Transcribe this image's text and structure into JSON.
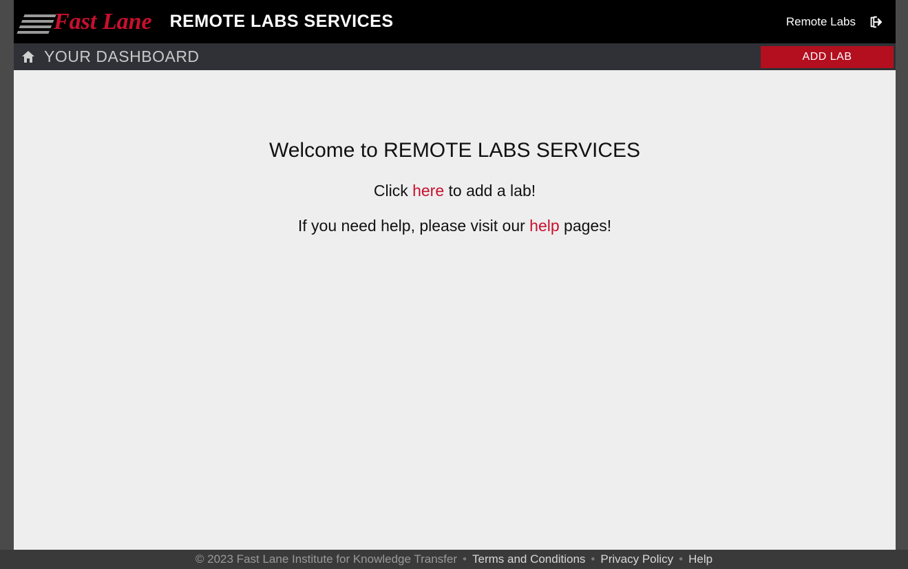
{
  "header": {
    "logo_text": "Fast Lane",
    "title": "REMOTE LABS SERVICES",
    "remote_labs_label": "Remote Labs"
  },
  "subheader": {
    "dashboard_title": "YOUR DASHBOARD",
    "add_lab_label": "ADD LAB"
  },
  "main": {
    "welcome_heading": "Welcome to REMOTE LABS SERVICES",
    "click_prefix": "Click ",
    "here_link": "here",
    "click_suffix": " to add a lab!",
    "help_prefix": "If you need help, please visit our ",
    "help_link": "help",
    "help_suffix": " pages!"
  },
  "footer": {
    "copyright": "© 2023 Fast Lane Institute for Knowledge Transfer",
    "terms": "Terms and Conditions",
    "privacy": "Privacy Policy",
    "help": "Help",
    "separator": "•"
  },
  "colors": {
    "accent_red": "#c8102e",
    "btn_red": "#b30f1f",
    "bg_dark": "#000000",
    "bg_sub": "#2f3136",
    "bg_main": "#eeeeee",
    "bg_page": "#4a4a4a"
  }
}
